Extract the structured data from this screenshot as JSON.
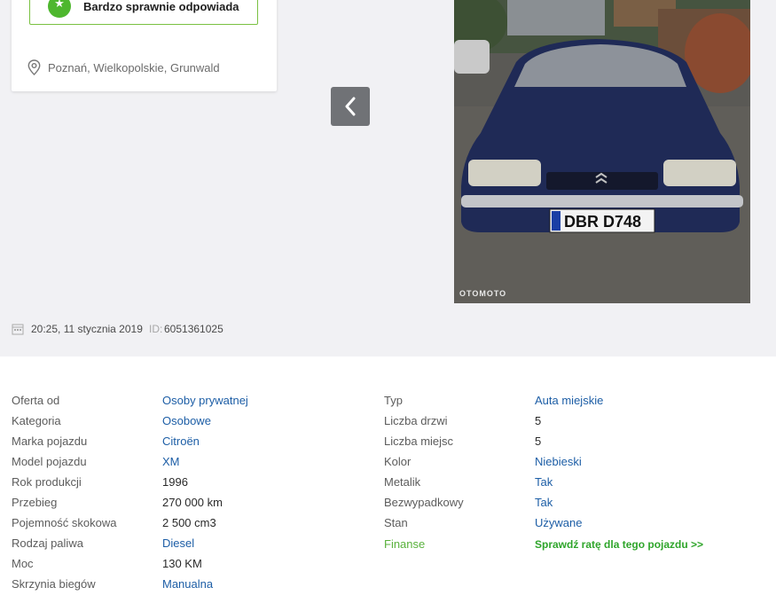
{
  "seller": {
    "badge_label": "Bardzo sprawnie odpowiada",
    "location": "Poznań, Wielkopolskie, Grunwald"
  },
  "gallery": {
    "watermark": "OTOMOTO",
    "plate_text": "DBR D748"
  },
  "meta": {
    "date": "20:25, 11 stycznia 2019",
    "id_label": "ID:",
    "id": "6051361025"
  },
  "params_left": [
    {
      "label": "Oferta od",
      "value": "Osoby prywatnej",
      "link": true
    },
    {
      "label": "Kategoria",
      "value": "Osobowe",
      "link": true
    },
    {
      "label": "Marka pojazdu",
      "value": "Citroën",
      "link": true
    },
    {
      "label": "Model pojazdu",
      "value": "XM",
      "link": true
    },
    {
      "label": "Rok produkcji",
      "value": "1996",
      "link": false
    },
    {
      "label": "Przebieg",
      "value": "270 000 km",
      "link": false
    },
    {
      "label": "Pojemność skokowa",
      "value": "2 500 cm3",
      "link": false
    },
    {
      "label": "Rodzaj paliwa",
      "value": "Diesel",
      "link": true
    },
    {
      "label": "Moc",
      "value": "130 KM",
      "link": false
    },
    {
      "label": "Skrzynia biegów",
      "value": "Manualna",
      "link": true
    }
  ],
  "params_right": [
    {
      "label": "Typ",
      "value": "Auta miejskie",
      "link": true
    },
    {
      "label": "Liczba drzwi",
      "value": "5",
      "link": false
    },
    {
      "label": "Liczba miejsc",
      "value": "5",
      "link": false
    },
    {
      "label": "Kolor",
      "value": "Niebieski",
      "link": true
    },
    {
      "label": "Metalik",
      "value": "Tak",
      "link": true
    },
    {
      "label": "Bezwypadkowy",
      "value": "Tak",
      "link": true
    },
    {
      "label": "Stan",
      "value": "Używane",
      "link": true
    },
    {
      "label": "Finanse",
      "value": "Sprawdź ratę dla tego pojazdu >>",
      "link": false
    }
  ],
  "colors": {
    "link": "#1d5ea6",
    "finance": "#2fa52b",
    "badge_border": "#7ac142",
    "background": "#f1f1f4"
  }
}
